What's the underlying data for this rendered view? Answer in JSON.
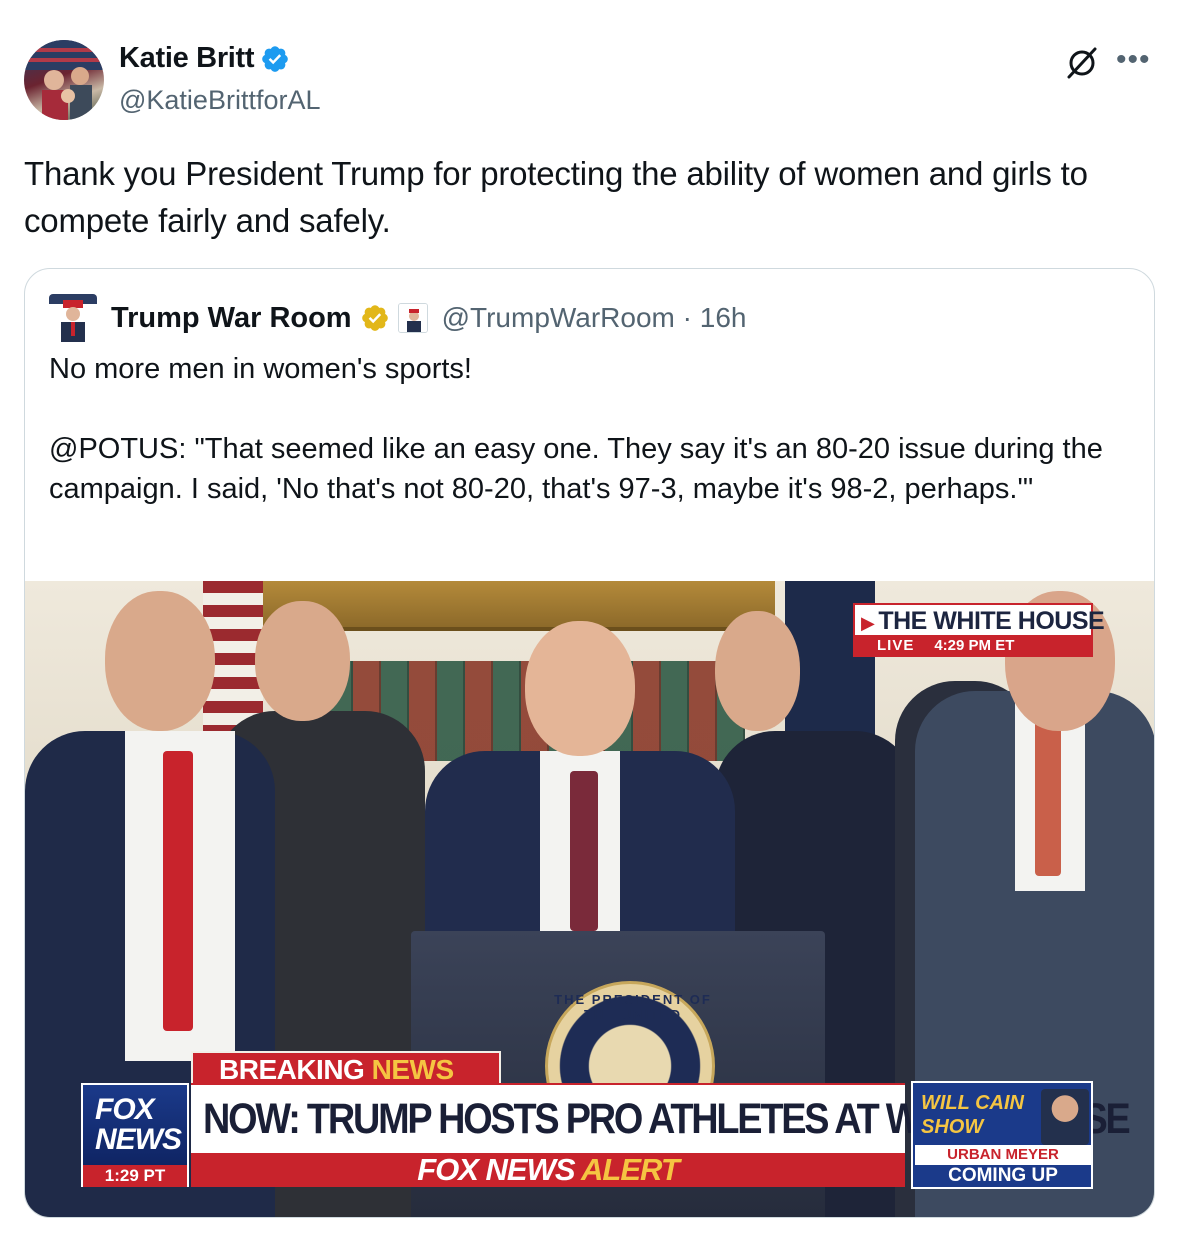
{
  "author": {
    "name": "Katie Britt",
    "handle": "@KatieBrittforAL"
  },
  "tweet": {
    "text": "Thank you President Trump for protecting the ability of women and girls to compete fairly and safely."
  },
  "quoted": {
    "name": "Trump War Room",
    "handle": "@TrumpWarRoom",
    "separator": "·",
    "time": "16h",
    "text": "No more men in women's sports!\n\n@POTUS: \"That seemed like an easy one. They say it's an 80-20 issue during the campaign. I said, 'No that's not 80-20, that's 97-3, maybe it's 98-2, perhaps.'\""
  },
  "media": {
    "location_title": "THE WHITE HOUSE",
    "live_label": "LIVE",
    "live_time": "4:29 PM ET",
    "breaking_word": "BREAKING",
    "breaking_news_word": "NEWS",
    "headline": "NOW: TRUMP HOSTS PRO ATHLETES AT WHITE HOUSE",
    "alert_word_1": "FOX NEWS",
    "alert_word_2": "ALERT",
    "network_logo": "FOX NEWS",
    "network_time": "1:29 PT",
    "promo_show": "WILL CAIN SHOW",
    "promo_guest": "URBAN MEYER",
    "promo_upcoming": "COMING UP",
    "seal_text": "THE PRESIDENT OF THE UNITED"
  },
  "icons": {
    "verified": "verified-blue-badge-icon",
    "gold_verified": "verified-gold-badge-icon",
    "grok": "grok-icon",
    "more": "more-options-icon"
  },
  "colors": {
    "verified_blue": "#1d9bf0",
    "gold": "#e2b719",
    "fox_red": "#c8232c",
    "fox_blue": "#1b3a8a"
  }
}
